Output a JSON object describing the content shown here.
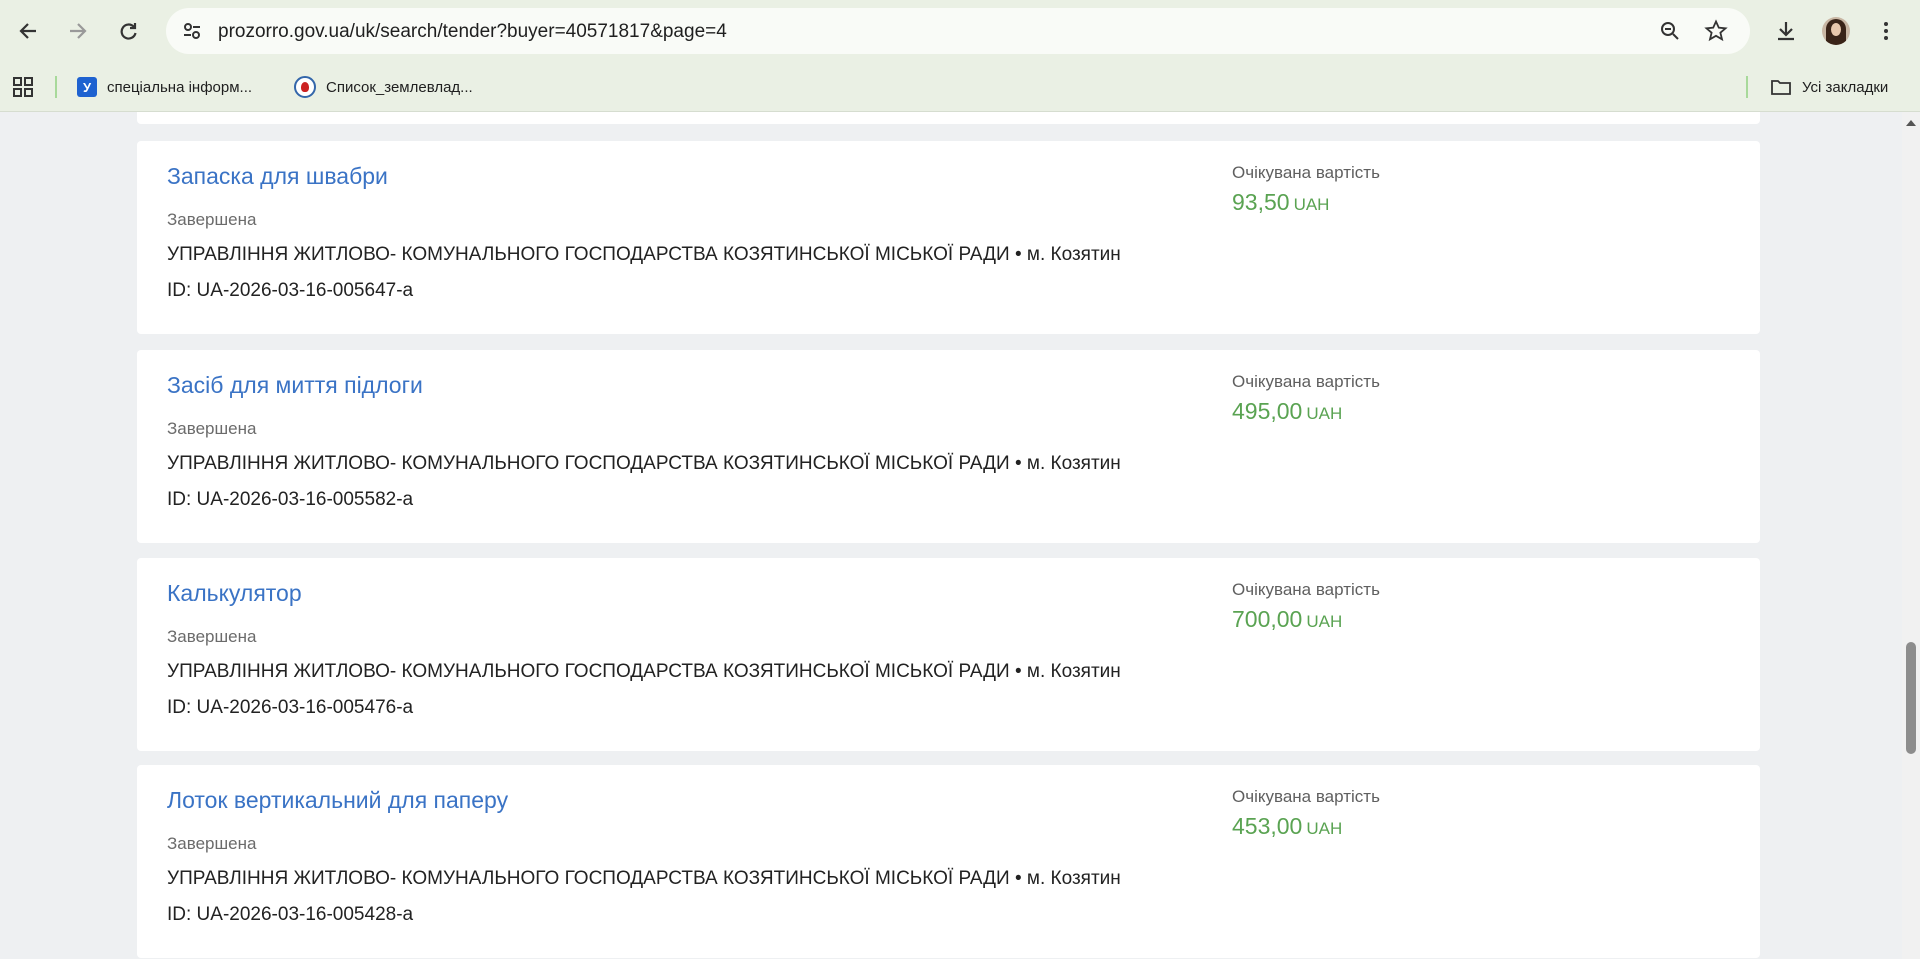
{
  "browser": {
    "url": "prozorro.gov.ua/uk/search/tender?buyer=40571817&page=4",
    "bookmarks": [
      {
        "label": "спеціальна інформ...",
        "icon": "y-favicon"
      },
      {
        "label": "Список_землевлад...",
        "icon": "wikimedia-favicon"
      }
    ],
    "all_bookmarks_label": "Усі закладки"
  },
  "colors": {
    "title_link": "#3a73c5",
    "price": "#5aa352",
    "toolbar_bg": "#eaf0e4"
  },
  "tenders": [
    {
      "title": "Запаска для швабри",
      "status": "Завершена",
      "buyer": "УПРАВЛІННЯ ЖИТЛОВО- КОМУНАЛЬНОГО ГОСПОДАРСТВА КОЗЯТИНСЬКОЇ МІСЬКОЇ РАДИ • м. Козятин",
      "id": "ID: UA-2026-03-16-005647-a",
      "price_label": "Очікувана вартість",
      "price": "93,50",
      "currency": "UAH"
    },
    {
      "title": "Засіб для миття підлоги",
      "status": "Завершена",
      "buyer": "УПРАВЛІННЯ ЖИТЛОВО- КОМУНАЛЬНОГО ГОСПОДАРСТВА КОЗЯТИНСЬКОЇ МІСЬКОЇ РАДИ • м. Козятин",
      "id": "ID: UA-2026-03-16-005582-a",
      "price_label": "Очікувана вартість",
      "price": "495,00",
      "currency": "UAH"
    },
    {
      "title": "Калькулятор",
      "status": "Завершена",
      "buyer": "УПРАВЛІННЯ ЖИТЛОВО- КОМУНАЛЬНОГО ГОСПОДАРСТВА КОЗЯТИНСЬКОЇ МІСЬКОЇ РАДИ • м. Козятин",
      "id": "ID: UA-2026-03-16-005476-a",
      "price_label": "Очікувана вартість",
      "price": "700,00",
      "currency": "UAH"
    },
    {
      "title": "Лоток вертикальний для паперу",
      "status": "Завершена",
      "buyer": "УПРАВЛІННЯ ЖИТЛОВО- КОМУНАЛЬНОГО ГОСПОДАРСТВА КОЗЯТИНСЬКОЇ МІСЬКОЇ РАДИ • м. Козятин",
      "id": "ID: UA-2026-03-16-005428-a",
      "price_label": "Очікувана вартість",
      "price": "453,00",
      "currency": "UAH"
    }
  ]
}
